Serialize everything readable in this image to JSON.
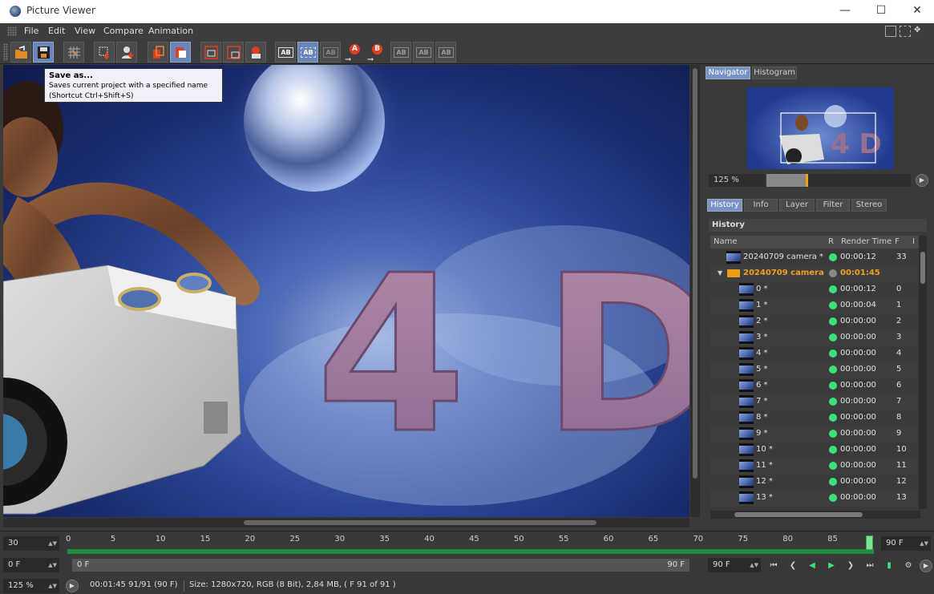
{
  "window": {
    "title": "Picture Viewer"
  },
  "menu": [
    "File",
    "Edit",
    "View",
    "Compare",
    "Animation"
  ],
  "tooltip": {
    "title": "Save as...",
    "line1": "Saves current project with a specified name",
    "line2": "(Shortcut Ctrl+Shift+S)"
  },
  "toolbar": {
    "icons": [
      "open-icon",
      "save-as-icon",
      "grid-icon",
      "export-icon",
      "save-user-icon",
      "copy-icon",
      "paste-icon",
      "region-icon",
      "region-alt-icon",
      "render-icon",
      "ab-icon",
      "ab-active-icon",
      "ab-disabled-icon",
      "set-a-icon",
      "set-b-icon",
      "compare-1-icon",
      "compare-2-icon",
      "compare-3-icon"
    ],
    "ab_label": "AB",
    "a_label": "A",
    "b_label": "B"
  },
  "scene": {
    "text": "4 D"
  },
  "navigator": {
    "tabs": [
      "Navigator",
      "Histogram"
    ],
    "zoom": "125 %",
    "zoom_fraction": 0.28
  },
  "panel_tabs": [
    "History",
    "Info",
    "Layer",
    "Filter",
    "Stereo"
  ],
  "history": {
    "heading": "History",
    "columns": {
      "name": "Name",
      "r": "R",
      "render_time": "Render Time",
      "f": "F",
      "extra": "I"
    },
    "rows": [
      {
        "name": "20240709 camera *",
        "time": "00:00:12",
        "frames": "33",
        "type": "item",
        "status": "green"
      },
      {
        "name": "20240709 camera",
        "time": "00:01:45",
        "frames": "",
        "type": "folder",
        "status": "gray"
      },
      {
        "name": "0 *",
        "time": "00:00:12",
        "frames": "0",
        "type": "child",
        "status": "green"
      },
      {
        "name": "1 *",
        "time": "00:00:04",
        "frames": "1",
        "type": "child",
        "status": "green"
      },
      {
        "name": "2 *",
        "time": "00:00:00",
        "frames": "2",
        "type": "child",
        "status": "green"
      },
      {
        "name": "3 *",
        "time": "00:00:00",
        "frames": "3",
        "type": "child",
        "status": "green"
      },
      {
        "name": "4 *",
        "time": "00:00:00",
        "frames": "4",
        "type": "child",
        "status": "green"
      },
      {
        "name": "5 *",
        "time": "00:00:00",
        "frames": "5",
        "type": "child",
        "status": "green"
      },
      {
        "name": "6 *",
        "time": "00:00:00",
        "frames": "6",
        "type": "child",
        "status": "green"
      },
      {
        "name": "7 *",
        "time": "00:00:00",
        "frames": "7",
        "type": "child",
        "status": "green"
      },
      {
        "name": "8 *",
        "time": "00:00:00",
        "frames": "8",
        "type": "child",
        "status": "green"
      },
      {
        "name": "9 *",
        "time": "00:00:00",
        "frames": "9",
        "type": "child",
        "status": "green"
      },
      {
        "name": "10 *",
        "time": "00:00:00",
        "frames": "10",
        "type": "child",
        "status": "green"
      },
      {
        "name": "11 *",
        "time": "00:00:00",
        "frames": "11",
        "type": "child",
        "status": "green"
      },
      {
        "name": "12 *",
        "time": "00:00:00",
        "frames": "12",
        "type": "child",
        "status": "green"
      },
      {
        "name": "13 *",
        "time": "00:00:00",
        "frames": "13",
        "type": "child",
        "status": "green"
      }
    ]
  },
  "timeline": {
    "fps": "30",
    "ticks": [
      "0",
      "5",
      "10",
      "15",
      "20",
      "25",
      "30",
      "35",
      "40",
      "45",
      "50",
      "55",
      "60",
      "65",
      "70",
      "75",
      "80",
      "85"
    ],
    "end_frame": "90 F",
    "start_field": "0 F",
    "range_start": "0 F",
    "range_end": "90 F",
    "current_field": "90 F"
  },
  "status": {
    "zoom": "125 %",
    "time": "00:01:45 91/91 (90 F)",
    "info": "Size: 1280x720, RGB (8 Bit), 2,84 MB, ( F 91 of 91 )"
  }
}
